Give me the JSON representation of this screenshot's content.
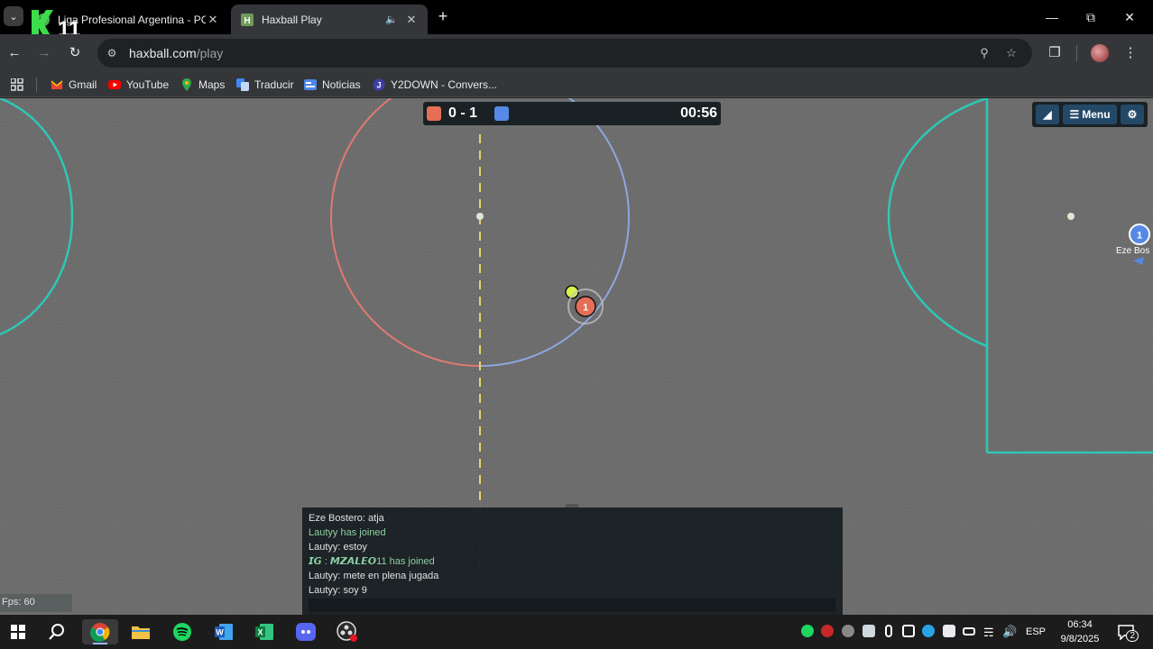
{
  "browser": {
    "tabs": [
      {
        "title": "Liga Profesional Argentina - PC",
        "active": false
      },
      {
        "title": "Haxball Play",
        "active": true
      }
    ],
    "overlay_logo_text": "11",
    "url_host": "haxball.com",
    "url_path": "/play",
    "bookmarks": [
      "Gmail",
      "YouTube",
      "Maps",
      "Traducir",
      "Noticias",
      "Y2DOWN - Convers..."
    ]
  },
  "game": {
    "score": "0 - 1",
    "time": "00:56",
    "red_color": "#e56e56",
    "blue_color": "#5689e5",
    "controls": {
      "sound_icon": "speaker-icon",
      "menu_label": "Menu",
      "settings_icon": "gear-icon"
    },
    "players": [
      {
        "team": "red",
        "number": "1"
      },
      {
        "team": "blue",
        "number": "1",
        "name": "Eze Bos"
      }
    ],
    "fps": "Fps: 60",
    "chat": [
      {
        "text": "Eze Bostero: atja",
        "kind": "msg"
      },
      {
        "text": "Lautyy has joined",
        "kind": "join"
      },
      {
        "text": "Lautyy: estoy",
        "kind": "msg"
      },
      {
        "text": "𝙄𝙂 : 𝙈𝙕𝘼𝙇𝙀𝙊11 has joined",
        "kind": "join"
      },
      {
        "text": "Lautyy: mete en plena jugada",
        "kind": "msg"
      },
      {
        "text": "Lautyy: soy 9",
        "kind": "msg"
      }
    ]
  },
  "taskbar": {
    "apps": [
      "start-icon",
      "search-icon",
      "chrome-icon",
      "file-explorer-icon",
      "spotify-icon",
      "word-icon",
      "excel-icon",
      "discord-icon",
      "obs-icon"
    ],
    "language": "ESP",
    "time": "06:34",
    "date": "9/8/2025",
    "notifications": "2"
  }
}
